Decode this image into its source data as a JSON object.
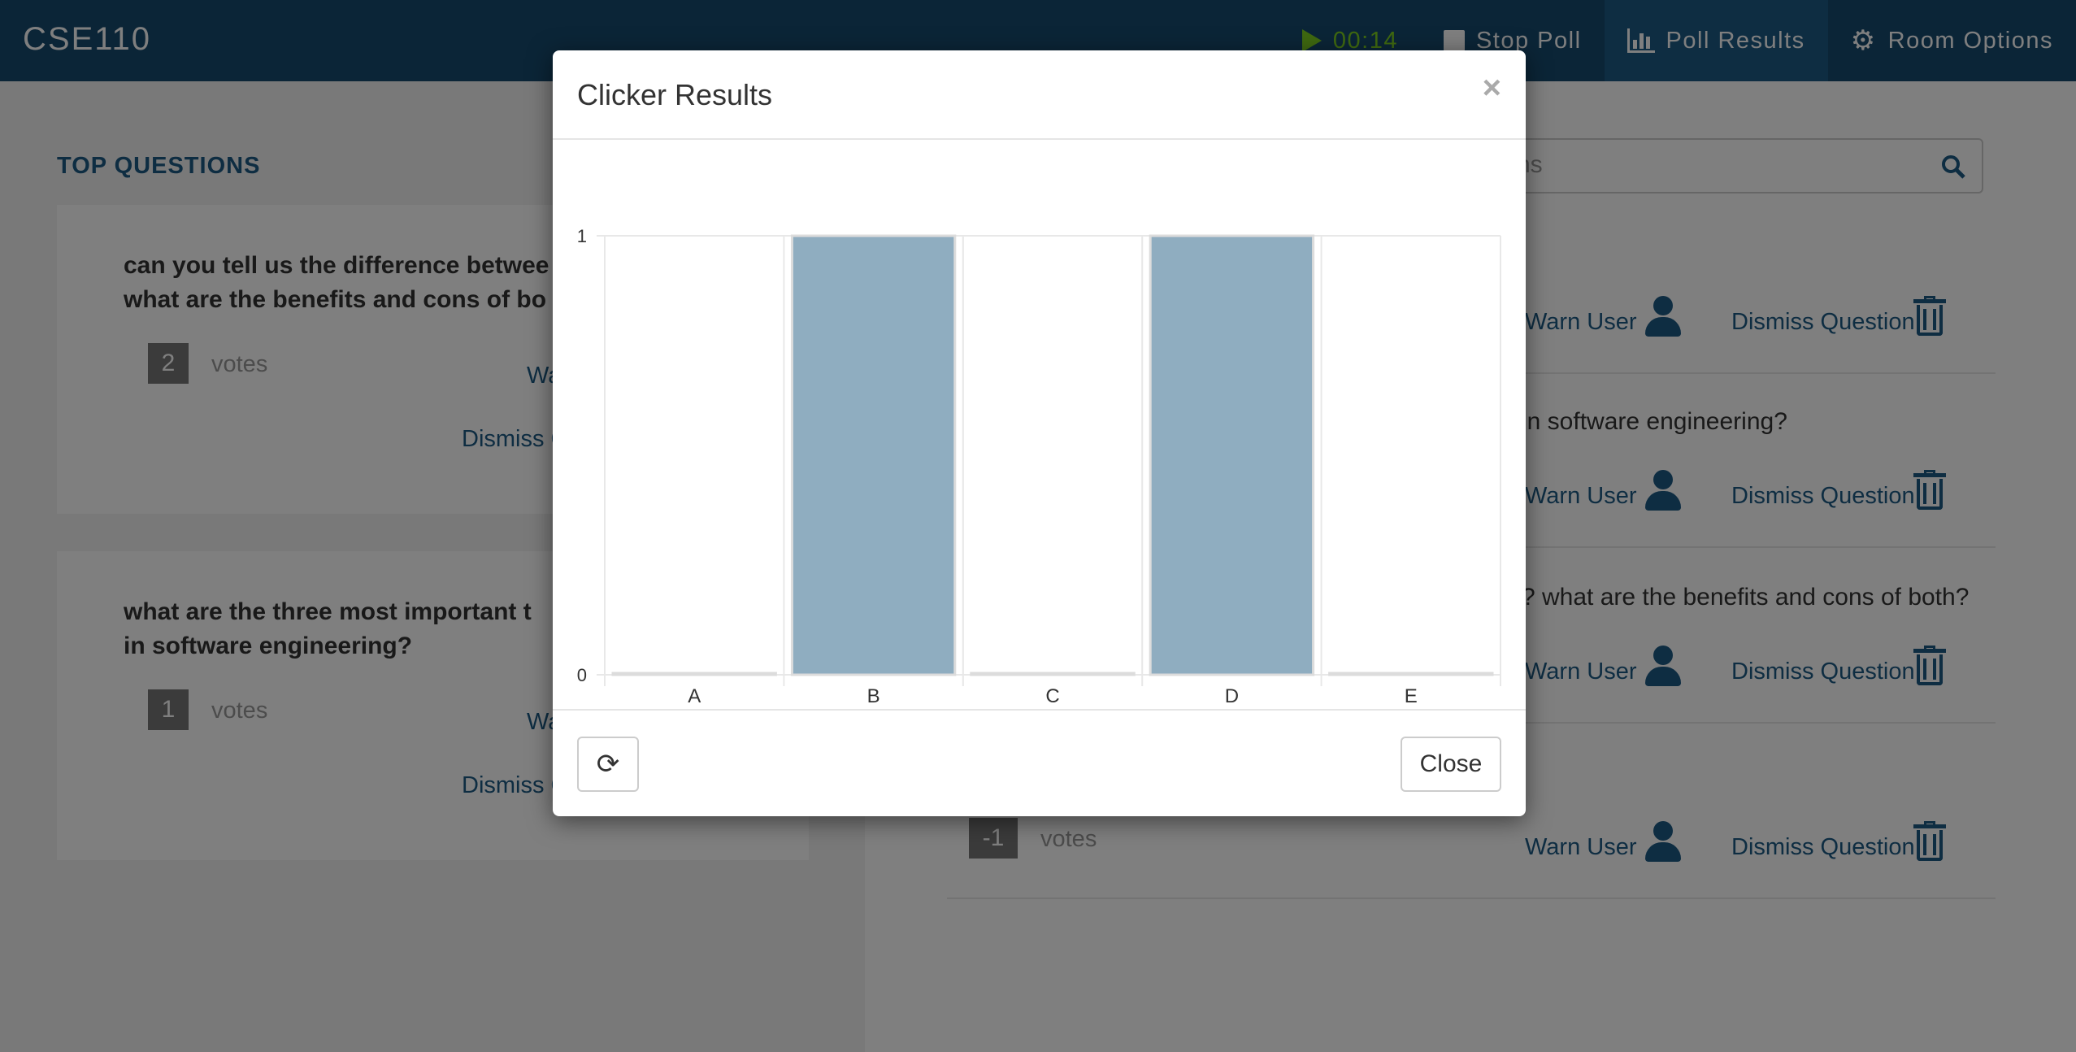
{
  "navbar": {
    "brand": "CSE110",
    "timer": "00:14",
    "stop_poll": "Stop Poll",
    "poll_results": "Poll Results",
    "room_options": "Room Options"
  },
  "left": {
    "section_title": "TOP QUESTIONS",
    "cards": [
      {
        "question_line1": "can you tell us the difference betwee",
        "question_line2": "what are the benefits and cons of bo",
        "votes": "2",
        "votes_label": "votes",
        "warn": "Wa",
        "dismiss": "Dismiss Q"
      },
      {
        "question_line1": "what are the three most important t",
        "question_line2": "in software engineering?",
        "votes": "1",
        "votes_label": "votes",
        "warn": "Wa",
        "dismiss": "Dismiss Q"
      }
    ]
  },
  "right": {
    "search_placeholder": "ns",
    "rows": [
      {
        "text": "",
        "warn": "Warn User",
        "dismiss": "Dismiss Question"
      },
      {
        "text": "in software engineering?",
        "warn": "Warn User",
        "dismiss": "Dismiss Question"
      },
      {
        "text": "? what are the benefits and cons of both?",
        "warn": "Warn User",
        "dismiss": "Dismiss Question"
      },
      {
        "text": "",
        "votes": "-1",
        "votes_label": "votes",
        "warn": "Warn User",
        "dismiss": "Dismiss Question"
      }
    ]
  },
  "modal": {
    "title": "Clicker Results",
    "close_x": "×",
    "close_button": "Close",
    "refresh_icon": "refresh-icon"
  },
  "chart_data": {
    "type": "bar",
    "categories": [
      "A",
      "B",
      "C",
      "D",
      "E"
    ],
    "values": [
      0,
      1,
      0,
      1,
      0
    ],
    "ylim": [
      0,
      1
    ],
    "yticks": [
      "0",
      "1"
    ],
    "bar_color": "#8fadc0",
    "grid": true
  },
  "colors": {
    "navbar": "#174a6f",
    "accent": "#1d5a85",
    "timer": "#7ed321"
  }
}
